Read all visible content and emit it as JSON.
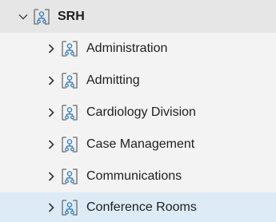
{
  "tree": {
    "root": {
      "label": "SRH",
      "expanded": true,
      "icon": "organizational-unit-icon"
    },
    "children": [
      {
        "label": "Administration",
        "icon": "organizational-unit-icon",
        "expanded": false,
        "selected": false
      },
      {
        "label": "Admitting",
        "icon": "organizational-unit-icon",
        "expanded": false,
        "selected": false
      },
      {
        "label": "Cardiology Division",
        "icon": "organizational-unit-icon",
        "expanded": false,
        "selected": false
      },
      {
        "label": "Case Management",
        "icon": "organizational-unit-icon",
        "expanded": false,
        "selected": false
      },
      {
        "label": "Communications",
        "icon": "organizational-unit-icon",
        "expanded": false,
        "selected": false
      },
      {
        "label": "Conference Rooms",
        "icon": "organizational-unit-icon",
        "expanded": false,
        "selected": true
      }
    ],
    "colors": {
      "selected_background": "#ddebf6",
      "root_background": "#e6e6e6",
      "panel_background": "#f3f3f3",
      "icon_accent": "#2f7bbf"
    }
  }
}
